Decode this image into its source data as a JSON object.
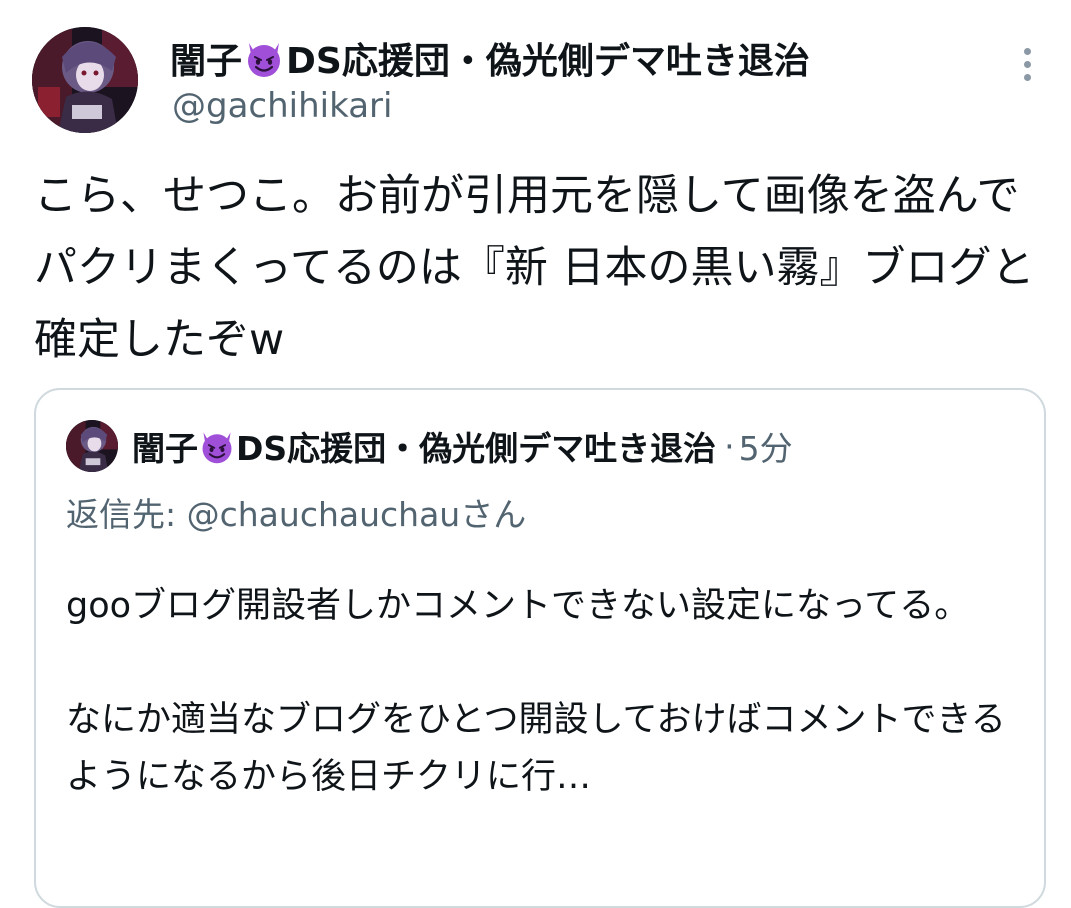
{
  "author": {
    "name_before": "闇子",
    "name_emoji": "smiling-devil-icon",
    "name_after": "DS応援団・偽光側デマ吐き退治",
    "handle": "@gachihikari"
  },
  "tweet": {
    "text": "こら、せつこ。お前が引用元を隠して画像を盗んでパクリまくってるのは『新 日本の黒い霧』ブログと確定したぞw"
  },
  "quoted_tweet": {
    "name_before": "闇子",
    "name_after": "DS応援団・偽光側デマ吐き退治",
    "separator": "·",
    "time": "5分",
    "reply_to_prefix": "返信先:",
    "reply_to_handle": "@chauchauchau",
    "reply_to_suffix": "さん",
    "paragraph_1": "gooブログ開設者しかコメントできない設定になってる。",
    "paragraph_2": "なにか適当なブログをひとつ開設しておけばコメントできるようになるから後日チクリに行…"
  },
  "colors": {
    "text": "#0f1419",
    "secondary": "#536471",
    "border": "#cfd9de",
    "emoji_purple": "#a050d8"
  }
}
